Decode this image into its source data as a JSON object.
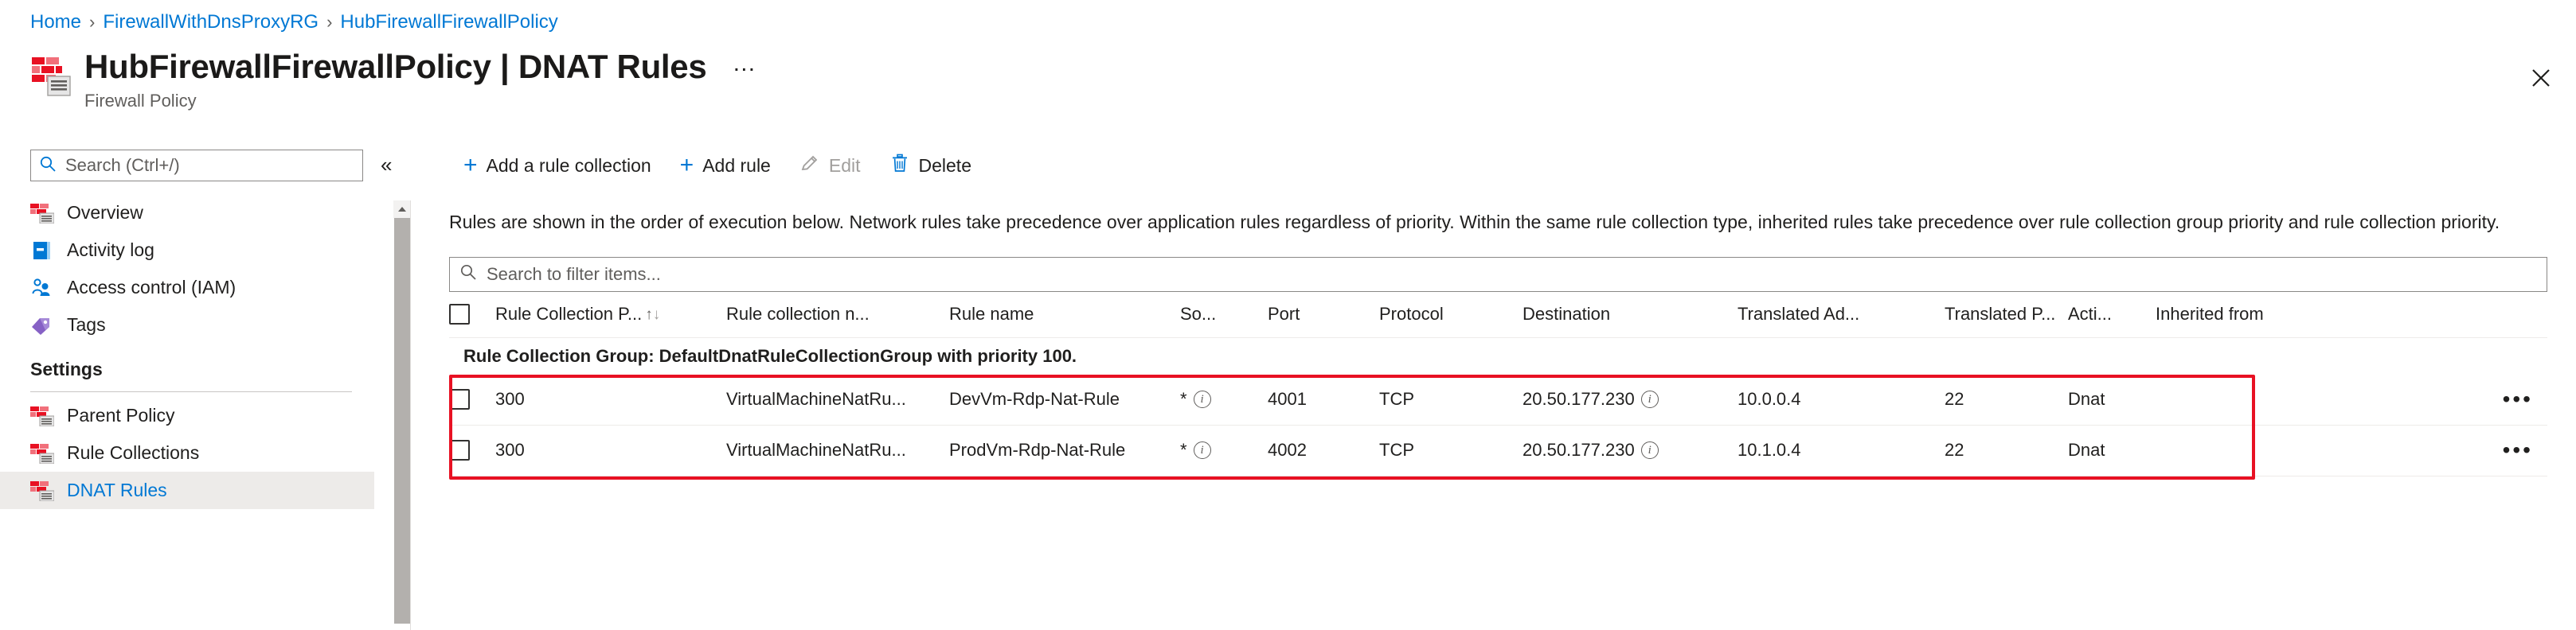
{
  "breadcrumb": {
    "items": [
      {
        "label": "Home"
      },
      {
        "label": "FirewallWithDnsProxyRG"
      },
      {
        "label": "HubFirewallFirewallPolicy"
      }
    ],
    "separator": "›"
  },
  "header": {
    "title": "HubFirewallFirewallPolicy | DNAT Rules",
    "subtitle": "Firewall Policy",
    "ellipsis": "…",
    "close_icon": "close-icon"
  },
  "sidebar": {
    "search": {
      "placeholder": "Search (Ctrl+/)",
      "value": "",
      "icon": "search-icon"
    },
    "collapse": {
      "label": "«"
    },
    "items": [
      {
        "label": "Overview",
        "icon": "firewall-icon",
        "selected": false
      },
      {
        "label": "Activity log",
        "icon": "activity-log-icon",
        "selected": false
      },
      {
        "label": "Access control (IAM)",
        "icon": "access-control-icon",
        "selected": false
      },
      {
        "label": "Tags",
        "icon": "tag-icon",
        "selected": false
      }
    ],
    "group_label": "Settings",
    "settings_items": [
      {
        "label": "Parent Policy",
        "icon": "firewall-icon",
        "selected": false
      },
      {
        "label": "Rule Collections",
        "icon": "firewall-icon",
        "selected": false
      },
      {
        "label": "DNAT Rules",
        "icon": "firewall-icon",
        "selected": true
      }
    ]
  },
  "toolbar": {
    "buttons": [
      {
        "label": "Add a rule collection",
        "icon": "plus-icon",
        "disabled": false
      },
      {
        "label": "Add rule",
        "icon": "plus-icon",
        "disabled": false
      },
      {
        "label": "Edit",
        "icon": "pencil-icon",
        "disabled": true
      },
      {
        "label": "Delete",
        "icon": "trash-icon",
        "disabled": false
      }
    ]
  },
  "main": {
    "description": "Rules are shown in the order of execution below. Network rules take precedence over application rules regardless of priority. Within the same rule collection type, inherited rules take precedence over rule collection group priority and rule collection priority.",
    "filter": {
      "placeholder": "Search to filter items...",
      "value": "",
      "icon": "search-icon"
    }
  },
  "table": {
    "columns": [
      {
        "key": "check",
        "label": ""
      },
      {
        "key": "priority",
        "label": "Rule Collection P...",
        "sorted": true,
        "sort_up": "↑",
        "sort_down": "↓"
      },
      {
        "key": "collection",
        "label": "Rule collection n..."
      },
      {
        "key": "rulename",
        "label": "Rule name"
      },
      {
        "key": "source",
        "label": "So..."
      },
      {
        "key": "port",
        "label": "Port"
      },
      {
        "key": "protocol",
        "label": "Protocol"
      },
      {
        "key": "destination",
        "label": "Destination"
      },
      {
        "key": "translated_address",
        "label": "Translated Ad..."
      },
      {
        "key": "translated_port",
        "label": "Translated P..."
      },
      {
        "key": "action",
        "label": "Acti..."
      },
      {
        "key": "inherited",
        "label": "Inherited from"
      }
    ],
    "group_row": "Rule Collection Group: DefaultDnatRuleCollectionGroup with priority 100.",
    "rows": [
      {
        "priority": "300",
        "collection": "VirtualMachineNatRu...",
        "rulename": "DevVm-Rdp-Nat-Rule",
        "source": "*",
        "source_info": true,
        "port": "4001",
        "protocol": "TCP",
        "destination": "20.50.177.230",
        "destination_info": true,
        "translated_address": "10.0.0.4",
        "translated_port": "22",
        "action": "Dnat",
        "inherited": "",
        "menu": "•••"
      },
      {
        "priority": "300",
        "collection": "VirtualMachineNatRu...",
        "rulename": "ProdVm-Rdp-Nat-Rule",
        "source": "*",
        "source_info": true,
        "port": "4002",
        "protocol": "TCP",
        "destination": "20.50.177.230",
        "destination_info": true,
        "translated_address": "10.1.0.4",
        "translated_port": "22",
        "action": "Dnat",
        "inherited": "",
        "menu": "•••"
      }
    ]
  },
  "colors": {
    "accent": "#0078d4",
    "highlight": "#e81123",
    "selected_bg": "#edebe9",
    "text": "#201f1e",
    "muted": "#605e5c"
  }
}
